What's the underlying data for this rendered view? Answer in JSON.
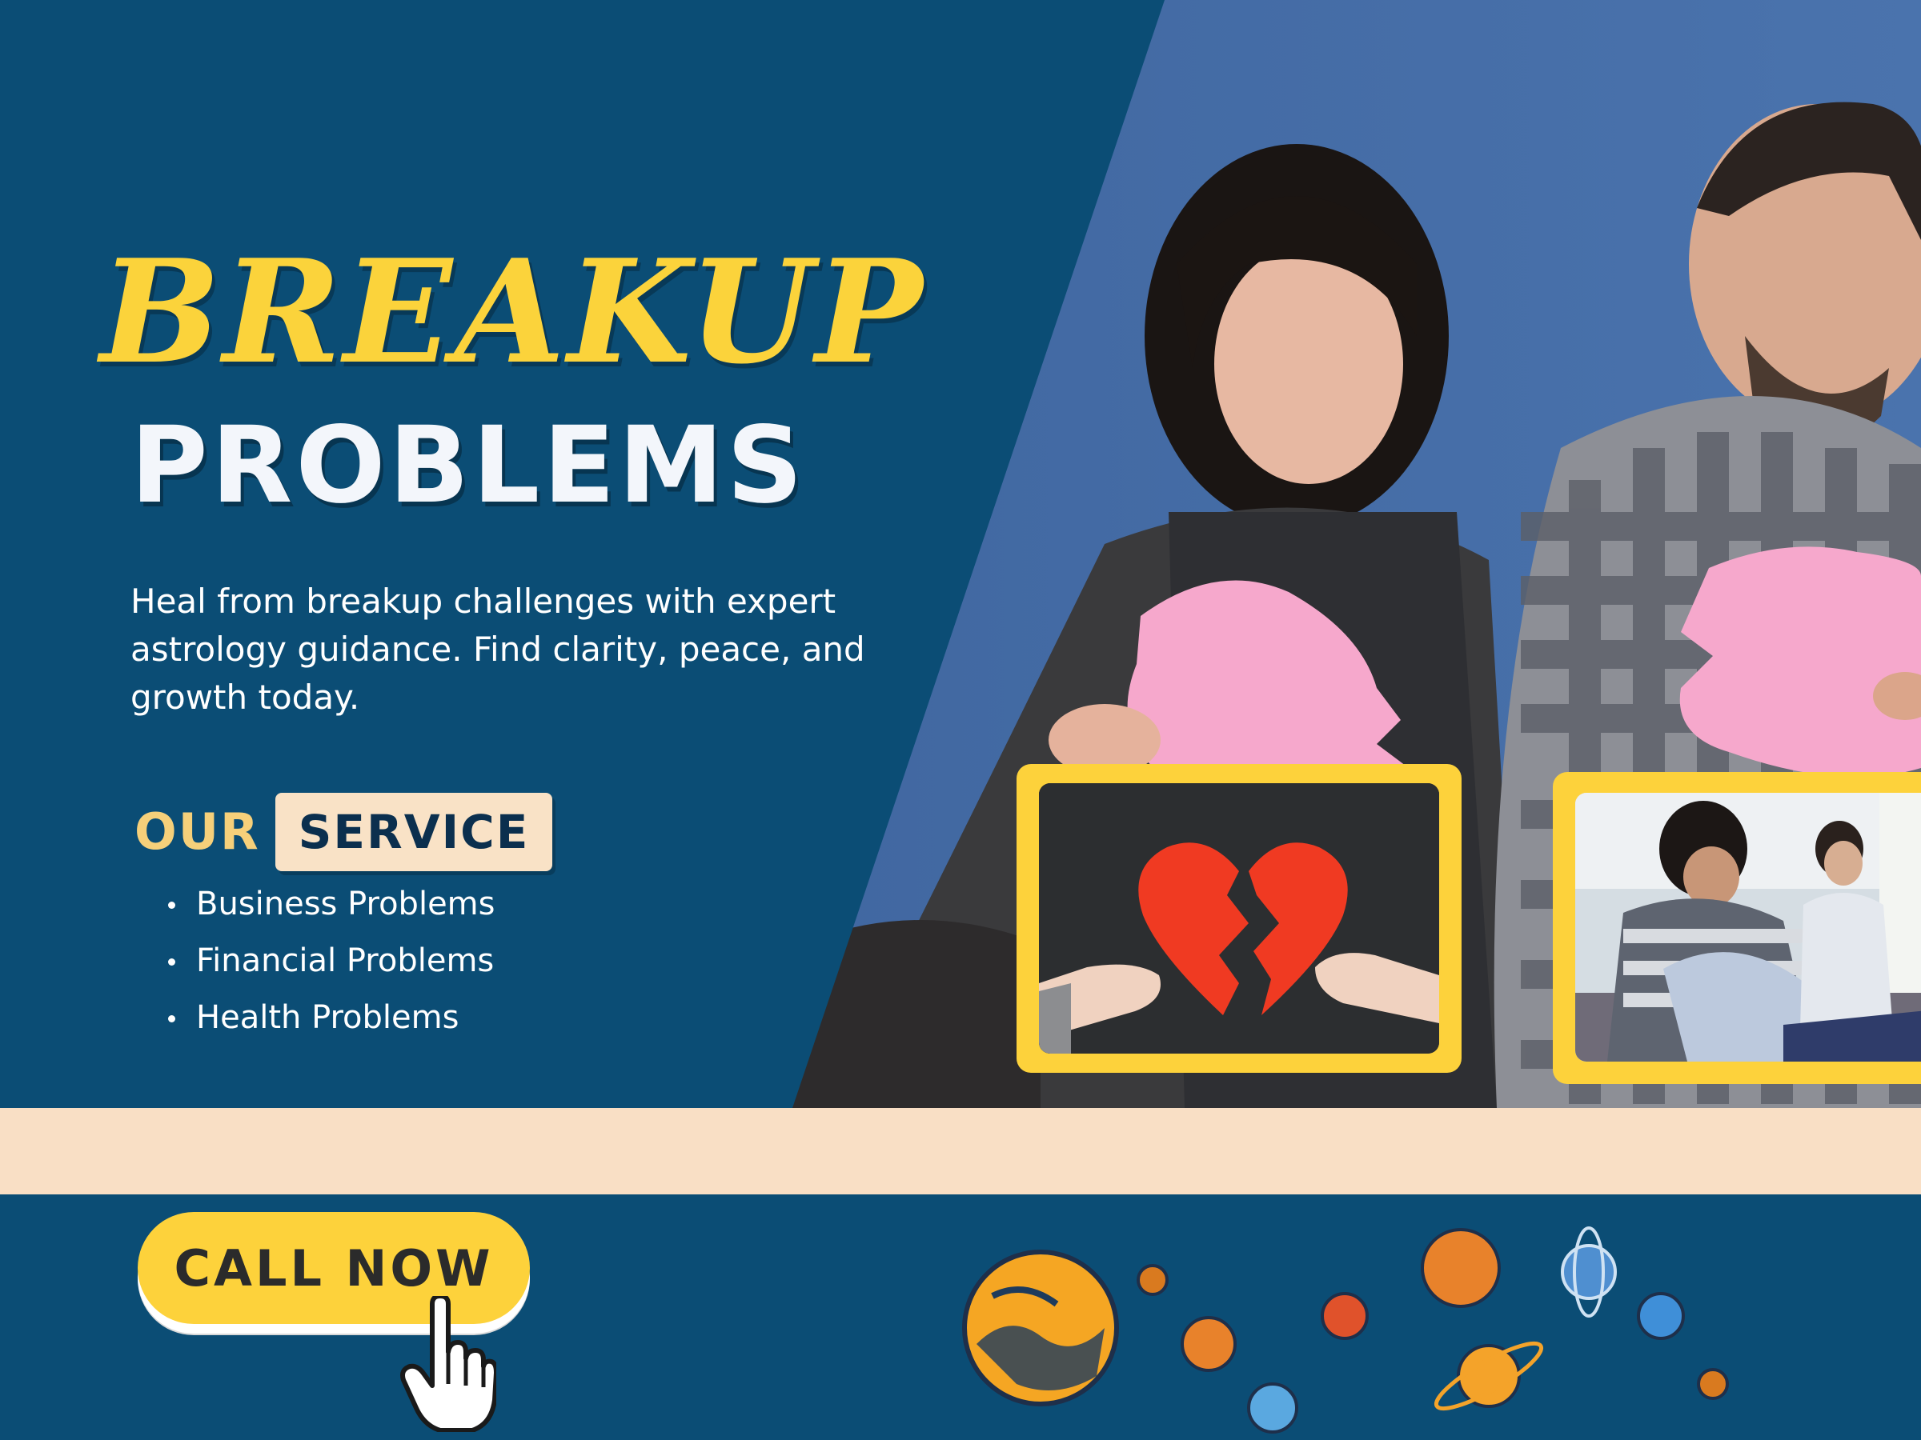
{
  "headline": {
    "line1": "BREAKUP",
    "line2": "PROBLEMS"
  },
  "description": "Heal from breakup challenges with expert astrology guidance. Find clarity, peace, and growth today.",
  "services": {
    "label_prefix": "OUR",
    "label_highlight": "SERVICE",
    "items": [
      "Business Problems",
      "Financial Problems",
      "Health Problems"
    ]
  },
  "cta": {
    "label": "CALL NOW"
  },
  "colors": {
    "background": "#0b4d75",
    "accent_yellow": "#fdd23b",
    "cream": "#f9dfc5",
    "heart_pink": "#f6a8cc",
    "heart_red": "#f03a22"
  },
  "icons": [
    "hand-pointer-icon",
    "planets-illustration"
  ]
}
